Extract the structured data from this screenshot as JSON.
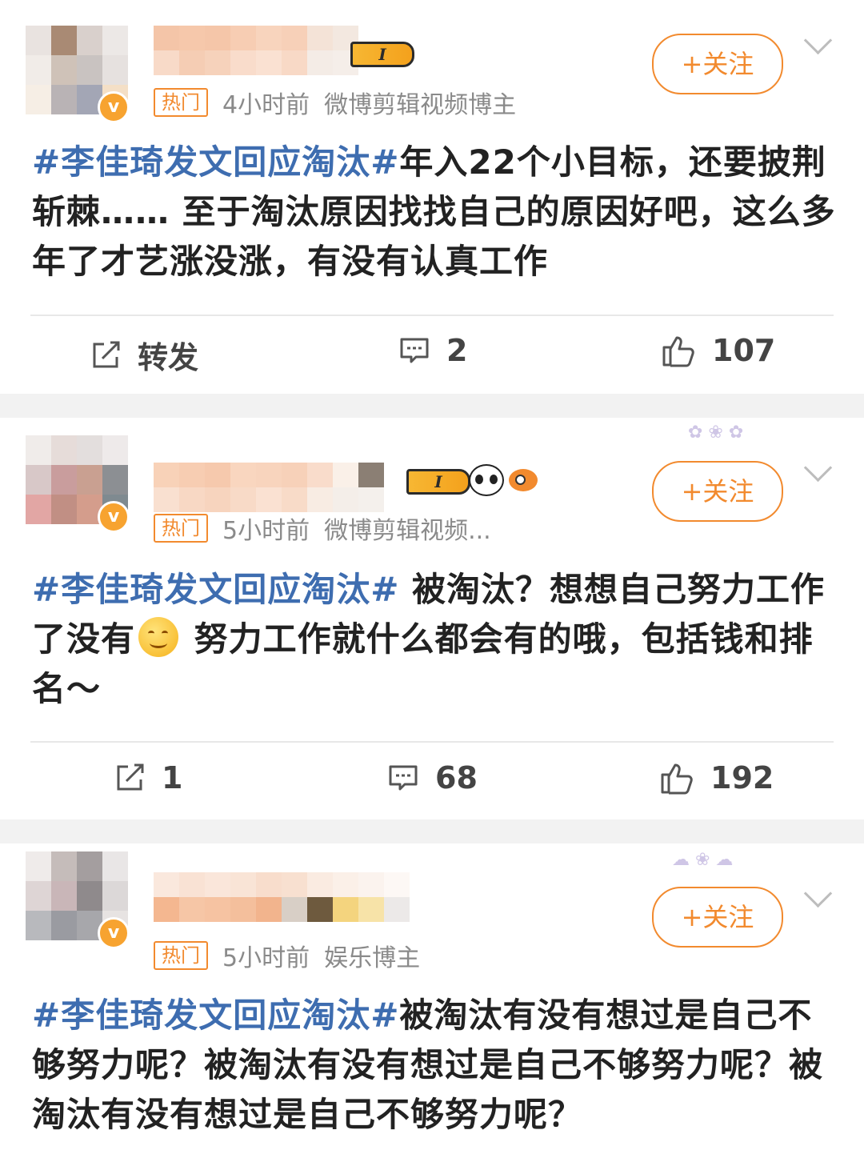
{
  "posts": [
    {
      "level": "I",
      "hot_badge": "热门",
      "time": "4小时前",
      "role": "微博剪辑视频博主",
      "follow": "+关注",
      "hashtag": "#李佳琦发文回应淘汰#",
      "body": "年入22个小目标，还要披荆斩棘…… 至于淘汰原因找找自己的原因好吧，这么多年了才艺涨没涨，有没有认真工作",
      "repost": "转发",
      "comments": "2",
      "likes": "107"
    },
    {
      "level": "I",
      "hot_badge": "热门",
      "time": "5小时前",
      "role": "微博剪辑视频...",
      "follow": "+关注",
      "hashtag": "#李佳琦发文回应淘汰#",
      "body_a": " 被淘汰？想想自己努力工作了没有",
      "emoji": "smile-emoji",
      "body_b": " 努力工作就什么都会有的哦，包括钱和排名～",
      "repost": "1",
      "comments": "68",
      "likes": "192"
    },
    {
      "hot_badge": "热门",
      "time": "5小时前",
      "role": "娱乐博主",
      "follow": "+关注",
      "hashtag": "#李佳琦发文回应淘汰#",
      "body": "被淘汰有没有想过是自己不够努力呢？被淘汰有没有想过是自己不够努力呢？被淘汰有没有想过是自己不够努力呢？"
    }
  ],
  "icons": {
    "repost": "repost-icon",
    "comment": "comment-icon",
    "like": "thumbs-up-icon",
    "more": "chevron-down-icon",
    "verified": "verified-v-icon"
  },
  "colors": {
    "accent_orange": "#f28a2e",
    "hashtag_blue": "#3e6db0",
    "meta_gray": "#8a8a8a",
    "separator": "#f2f2f2"
  }
}
